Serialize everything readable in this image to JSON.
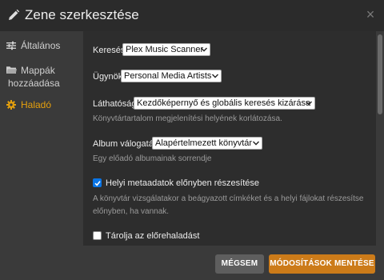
{
  "header": {
    "title": "Zene szerkesztése",
    "close_symbol": "×"
  },
  "sidebar": {
    "items": [
      {
        "icon": "sliders-icon",
        "label": "Általános"
      },
      {
        "icon": "folder-icon",
        "label_line1": "Mappák",
        "label_line2": "hozzáadása"
      },
      {
        "icon": "gear-icon",
        "label": "Haladó",
        "active": true
      }
    ]
  },
  "settings": {
    "search": {
      "label": "Keresés",
      "value": "Plex Music Scanner"
    },
    "agent": {
      "label": "Ügynök",
      "value": "Personal Media Artists"
    },
    "visibility": {
      "label": "Láthatóság",
      "value": "Kezdőképernyő és globális keresés kizárása",
      "help": "Könyvtártartalom megjelenítési helyének korlátozása."
    },
    "album_sort": {
      "label": "Album válogatás",
      "value": "Alapértelmezett könyvtár",
      "help": "Egy előadó albumainak sorrendje"
    },
    "local_metadata": {
      "label": "Helyi metaadatok előnyben részesítése",
      "checked": true,
      "help": "A könyvtár vizsgálatakor a beágyazott címkéket és a helyi fájlokat részesítse előnyben, ha vannak."
    },
    "store_progress": {
      "label": "Tárolja az előrehaladást",
      "checked": false
    }
  },
  "footer": {
    "cancel_label": "MÉGSEM",
    "save_label": "MÓDOSÍTÁSOK MENTÉSE"
  },
  "colors": {
    "accent": "#e5a00d",
    "save_button": "#cc7b19",
    "checkbox": "#0a75e6"
  }
}
